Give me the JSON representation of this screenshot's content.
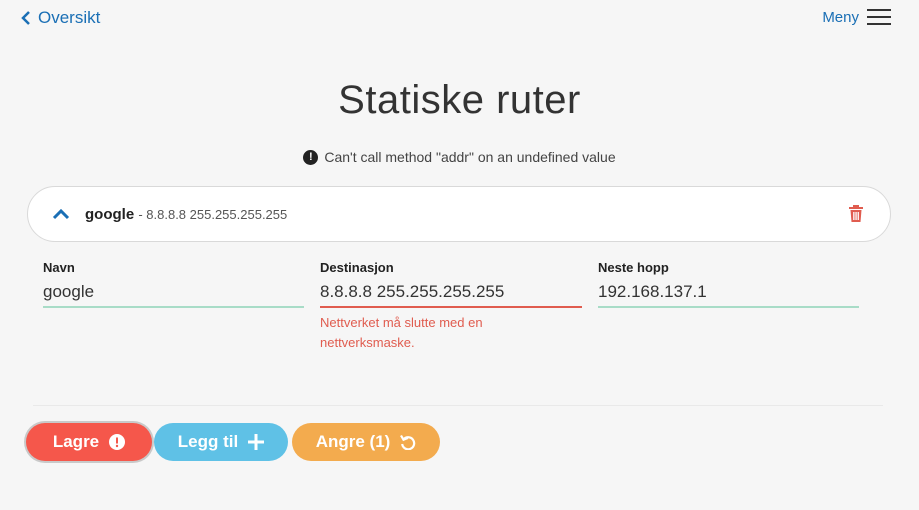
{
  "nav": {
    "back_label": "Oversikt",
    "menu_label": "Meny"
  },
  "page": {
    "title": "Statiske ruter",
    "error_message": "Can't call method \"addr\" on an undefined value"
  },
  "route": {
    "name": "google",
    "summary": "- 8.8.8.8 255.255.255.255",
    "expanded": true
  },
  "form": {
    "name_label": "Navn",
    "name_value": "google",
    "destination_label": "Destinasjon",
    "destination_value": "8.8.8.8 255.255.255.255",
    "destination_error": "Nettverket må slutte med en nettverksmaske.",
    "nexthop_label": "Neste hopp",
    "nexthop_value": "192.168.137.1"
  },
  "actions": {
    "save_label": "Lagre",
    "add_label": "Legg til",
    "undo_label": "Angre (1)"
  },
  "colors": {
    "accent": "#1a6fb5",
    "save": "#f5574b",
    "add": "#5fc1e6",
    "undo": "#f3ab4e",
    "error": "#e05c4f",
    "valid_underline": "#a8dcc7"
  },
  "icons": {
    "back": "chevron-left-icon",
    "menu": "hamburger-menu-icon",
    "warning": "exclamation-circle-icon",
    "collapse": "chevron-up-icon",
    "delete": "trash-icon",
    "add": "plus-icon",
    "undo": "undo-icon"
  }
}
